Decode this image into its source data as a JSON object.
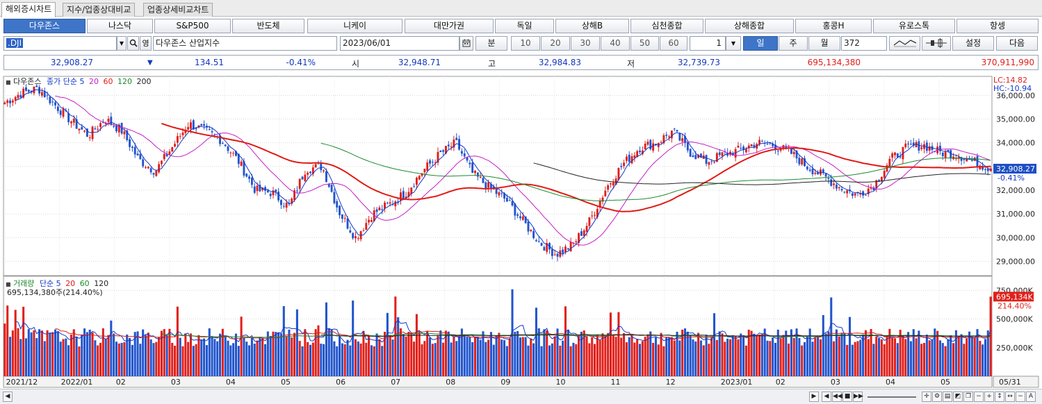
{
  "tabs": [
    {
      "label": "해외증시차트",
      "active": true
    },
    {
      "label": "지수/업종상대비교",
      "active": false
    },
    {
      "label": "업종상세비교차트",
      "active": false
    }
  ],
  "markets": [
    "다우존스",
    "나스닥",
    "S&P500",
    "반도체",
    "니케이",
    "대만가권",
    "독일",
    "상해B",
    "심천종합",
    "상해종합",
    "홍콩H",
    "유로스톡",
    "항셍"
  ],
  "controls": {
    "symbol": ".DJI",
    "name": "다우존스 산업지수",
    "date": "2023/06/01",
    "minute_label": "분",
    "intervals": [
      "10",
      "20",
      "30",
      "40",
      "50",
      "60"
    ],
    "step_value": "1",
    "period_day": "일",
    "period_week": "주",
    "period_month": "월",
    "count": "372",
    "settings_label": "설정",
    "next_label": "다음",
    "eng_label": "영"
  },
  "quote": {
    "price": "32,908.27",
    "change": "134.51",
    "change_pct": "-0.41%",
    "open_label": "시",
    "open": "32,948.71",
    "high_label": "고",
    "high": "32,984.83",
    "low_label": "저",
    "low": "32,739.73",
    "volume": "695,134,380",
    "amount": "370,911,990"
  },
  "legend": {
    "price_name": "다우존스",
    "price_ma_label": "종가 단순 5",
    "ma_periods": [
      "20",
      "60",
      "120",
      "200"
    ],
    "volume_name": "거래량",
    "volume_ma_label": "단순 5",
    "volume_ma_periods": [
      "20",
      "60",
      "120"
    ],
    "volume_info": "695,134,380주(214.40%)",
    "lc": "LC:14.82",
    "hc": "HC:-10.94"
  },
  "chart_data": {
    "type": "candlestick",
    "price_axis": [
      "36,000.00",
      "35,000.00",
      "34,000.00",
      "33,000.00",
      "32,000.00",
      "31,000.00",
      "30,000.00",
      "29,000.00"
    ],
    "price_ylim": [
      28400,
      36800
    ],
    "current_price": "32,908.27",
    "current_pct": "-0.41%",
    "volume_axis": [
      "750,000K",
      "500,000K",
      "250,000K"
    ],
    "volume_ylim": [
      0,
      800000
    ],
    "current_volume": "695,134K",
    "current_volume_pct": "214.40%",
    "x_labels": [
      "2021/12",
      "2022/01",
      "02",
      "03",
      "04",
      "05",
      "06",
      "07",
      "08",
      "09",
      "10",
      "11",
      "12",
      "2023/01",
      "02",
      "03",
      "04",
      "05",
      "05/31"
    ],
    "closes_weekly": [
      35700,
      36100,
      36300,
      35600,
      34900,
      34300,
      35000,
      34500,
      33300,
      32800,
      33800,
      34800,
      34500,
      34100,
      33200,
      32000,
      31900,
      31300,
      32900,
      33000,
      31100,
      30000,
      31000,
      31400,
      31900,
      32800,
      33500,
      34000,
      32700,
      32100,
      31600,
      30700,
      29800,
      29300,
      29700,
      30700,
      32100,
      33100,
      33800,
      34000,
      34500,
      33600,
      33200,
      33500,
      33700,
      34000,
      33900,
      33600,
      33000,
      32600,
      32100,
      31800,
      32200,
      33300,
      33800,
      33900,
      33600,
      33500,
      33200,
      32908
    ],
    "ma_colors": {
      "ma5": "#1238c8",
      "ma20": "#c41fc4",
      "ma60": "#e01a14",
      "ma120": "#1c8a2c",
      "ma200": "#222222"
    },
    "up_color": "#e0201b",
    "down_color": "#2255cc"
  }
}
